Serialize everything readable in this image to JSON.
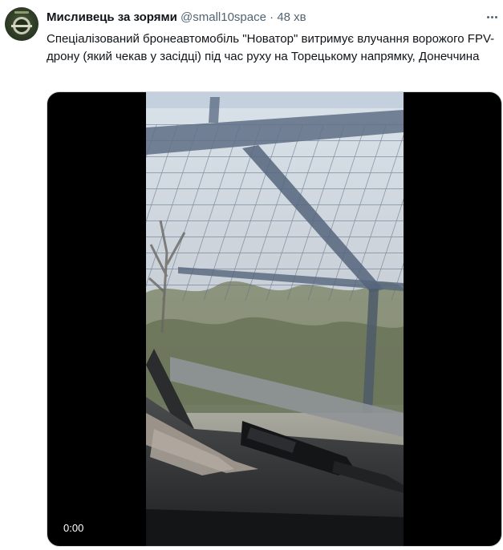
{
  "tweet": {
    "author_name": "Мисливець за зорями",
    "handle": "@small10space",
    "separator": "·",
    "time": "48 хв",
    "text": "Спеціалізований бронеавтомобіль \"Новатор\" витримує влучання ворожого FPV-дрону (який чекав у засідці) під час руху на Торецькому напрямку, Донеччина",
    "avatar_icon": "military-emblem-icon",
    "more_icon": "more-dots-icon"
  },
  "video": {
    "timestamp": "0:00",
    "letterbox_color": "#000000"
  },
  "colors": {
    "text": "#0f1419",
    "secondary": "#536471",
    "border": "#cfd9de"
  }
}
